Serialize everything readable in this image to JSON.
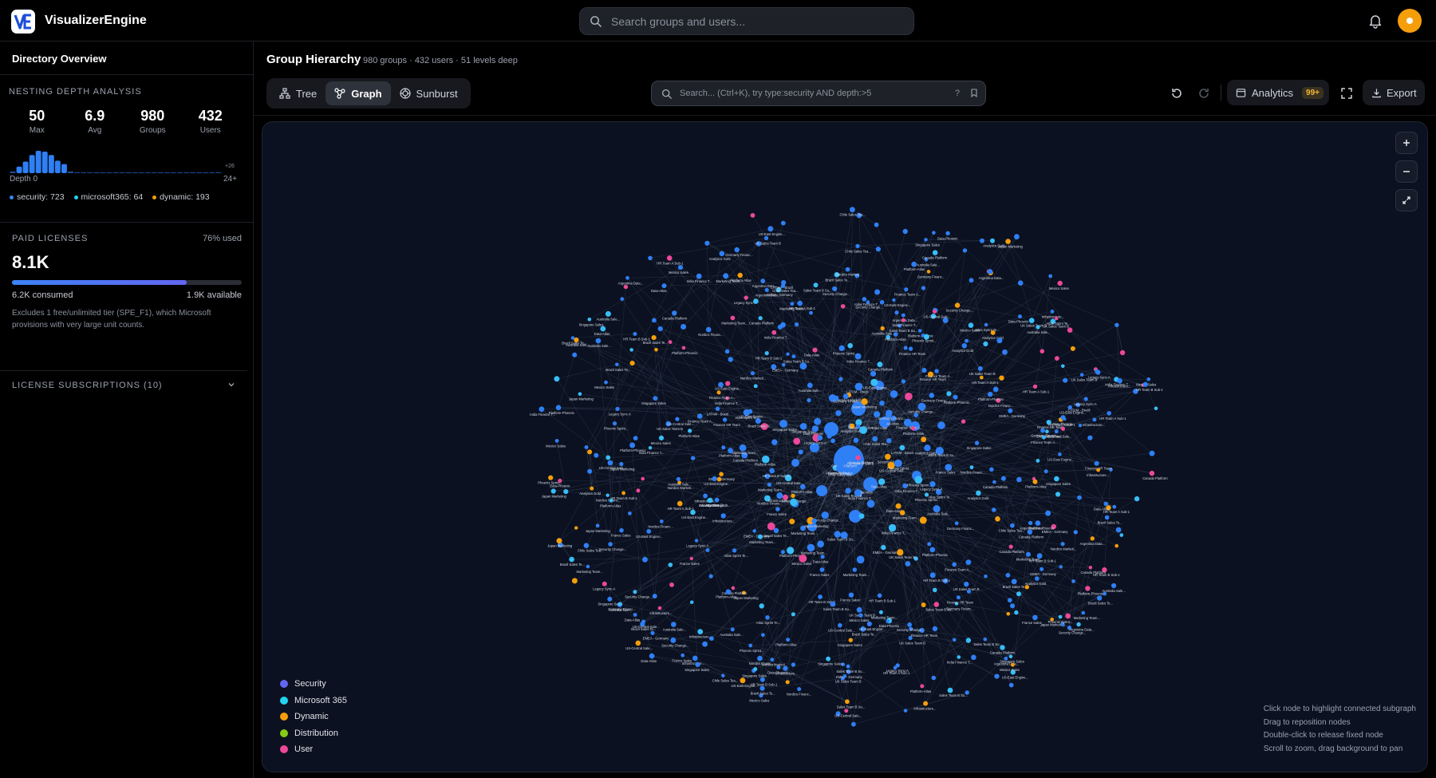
{
  "app": {
    "name": "VisualizerEngine"
  },
  "topbar": {
    "search_placeholder": "Search groups and users..."
  },
  "sidebar": {
    "title": "Directory Overview",
    "nesting": {
      "label": "NESTING DEPTH ANALYSIS",
      "stats": [
        {
          "value": "50",
          "label": "Max"
        },
        {
          "value": "6.9",
          "label": "Avg"
        },
        {
          "value": "980",
          "label": "Groups"
        },
        {
          "value": "432",
          "label": "Users"
        }
      ],
      "histogram_values": [
        2,
        8,
        14,
        22,
        27,
        26,
        22,
        15,
        11,
        2,
        1,
        1,
        1,
        1,
        1,
        1,
        1,
        1,
        1,
        1,
        1,
        1,
        1,
        1,
        1,
        1,
        1,
        1,
        1,
        1,
        1,
        1,
        1
      ],
      "axis_start": "Depth 0",
      "axis_end": "24+",
      "overflow_label": "+26",
      "legend": [
        {
          "label": "security: 723",
          "color": "#3b82f6"
        },
        {
          "label": "microsoft365: 64",
          "color": "#22d3ee"
        },
        {
          "label": "dynamic: 193",
          "color": "#f59e0b"
        }
      ]
    },
    "licenses": {
      "label": "PAID LICENSES",
      "used_pct_label": "76% used",
      "used_fraction": 0.76,
      "total": "8.1K",
      "consumed": "6.2K consumed",
      "available": "1.9K available",
      "note": "Excludes 1 free/unlimited tier (SPE_F1), which Microsoft provisions with very large unit counts."
    },
    "subscriptions": {
      "label": "LICENSE SUBSCRIPTIONS (10)"
    }
  },
  "main": {
    "title": "Group Hierarchy",
    "subtitle": "980 groups · 432 users · 51 levels deep",
    "tabs": [
      {
        "label": "Tree",
        "icon": "tree-icon",
        "active": false
      },
      {
        "label": "Graph",
        "icon": "graph-icon",
        "active": true
      },
      {
        "label": "Sunburst",
        "icon": "sunburst-icon",
        "active": false
      }
    ],
    "graph_search_placeholder": "Search... (Ctrl+K), try type:security AND depth:>5",
    "graph_search_help": "?",
    "analytics_label": "Analytics",
    "analytics_badge": "99+",
    "export_label": "Export"
  },
  "graph": {
    "legend": [
      {
        "label": "Security",
        "color": "#6366f1"
      },
      {
        "label": "Microsoft 365",
        "color": "#22d3ee"
      },
      {
        "label": "Dynamic",
        "color": "#f59e0b"
      },
      {
        "label": "Distribution",
        "color": "#84cc16"
      },
      {
        "label": "User",
        "color": "#ec4899"
      }
    ],
    "hints": [
      "Click node to highlight connected subgraph",
      "Drag to reposition nodes",
      "Double-click to release fixed node",
      "Scroll to zoom, drag background to pan"
    ],
    "node_colors": {
      "security": "#2f7ff5",
      "m365": "#38bdf8",
      "dynamic": "#f59e0b",
      "user": "#ec4899"
    },
    "node_label_samples": [
      "Sales Team B Su...",
      "Marketing Team...",
      "Finance Team A...",
      "Platform-Phoenix",
      "Data-Atlas",
      "Infrastructure...",
      "Argentina Data...",
      "Chile Sales Tea...",
      "Brazil Sales Te...",
      "US-Central Sale...",
      "Germany Financ...",
      "India Finance T...",
      "Nordics Marketi...",
      "Singapore Sales",
      "Mexico Sales",
      "Japan Marketing",
      "Canada Platform",
      "UK Sales Team B",
      "Australia Sale...",
      "France Sales",
      "Phoenix Sprint...",
      "Atlas Sprint Te...",
      "HR Team B Sub-1",
      "Security Change...",
      "LATAM - Brazil",
      "EMEA - Germany",
      "US-East Engine...",
      "Data-Phoenix",
      "Platform-Atlas",
      "Finance HR Team",
      "Analytics Gold",
      "Nordics Financ...",
      "Legacy Sync-A",
      "HR Team A Sub-1"
    ]
  }
}
